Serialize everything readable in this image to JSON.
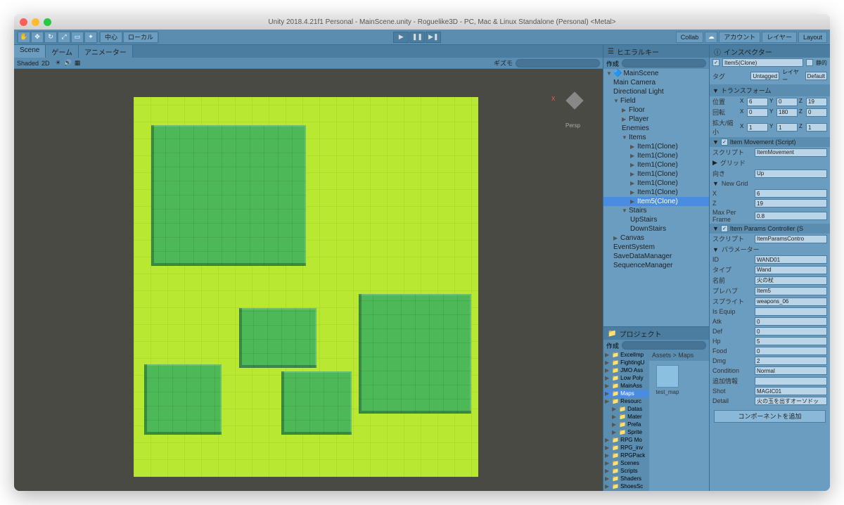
{
  "titlebar": "Unity 2018.4.21f1 Personal - MainScene.unity - Roguelike3D - PC, Mac & Linux Standalone (Personal) <Metal>",
  "toolbar": {
    "pivot": "中心",
    "local": "ローカル",
    "collab": "Collab",
    "account": "アカウント",
    "layers": "レイヤー",
    "layout": "Layout"
  },
  "sceneTabs": {
    "scene": "Scene",
    "game": "ゲーム",
    "animator": "アニメーター"
  },
  "sceneToolbar": {
    "shaded": "Shaded",
    "twod": "2D",
    "gizmos": "ギズモ"
  },
  "persp": "Persp",
  "hierarchy": {
    "title": "ヒエラルキー",
    "create": "作成",
    "scene": "MainScene",
    "items": [
      "Main Camera",
      "Directional Light",
      "Field",
      "Floor",
      "Player",
      "Enemies",
      "Items",
      "Item1(Clone)",
      "Item1(Clone)",
      "Item1(Clone)",
      "Item1(Clone)",
      "Item1(Clone)",
      "Item1(Clone)",
      "Item5(Clone)",
      "Stairs",
      "UpStairs",
      "DownStairs",
      "Canvas",
      "EventSystem",
      "SaveDataManager",
      "SequenceManager"
    ]
  },
  "project": {
    "title": "プロジェクト",
    "create": "作成",
    "breadcrumb": "Assets > Maps",
    "folders": [
      "ExcelImp",
      "FightingU",
      "JMO Ass",
      "Low Poly",
      "MainAss",
      "Maps",
      "Resourc",
      "Datas",
      "Mater",
      "Prefa",
      "Sprite",
      "RPG Mo",
      "RPG_inv",
      "RPGPack",
      "Scenes",
      "Scripts",
      "Shaders",
      "ShoesSc"
    ],
    "asset": "test_map"
  },
  "inspector": {
    "title": "インスペクター",
    "name": "Item5(Clone)",
    "static": "静的",
    "tag": "タグ",
    "tagValue": "Untagged",
    "layer": "レイヤー",
    "layerValue": "Default",
    "transform": {
      "title": "トランスフォーム",
      "pos": "位置",
      "rot": "回転",
      "scale": "拡大/縮小",
      "posX": "6",
      "posY": "0",
      "posZ": "19",
      "rotX": "0",
      "rotY": "180",
      "rotZ": "0",
      "sclX": "1",
      "sclY": "1",
      "sclZ": "1"
    },
    "itemMovement": {
      "title": "Item Movement (Script)",
      "script": "スクリプト",
      "scriptValue": "ItemMovement",
      "grid": "グリッド",
      "direction": "向き",
      "directionValue": "Up",
      "newGrid": "New Grid",
      "x": "X",
      "xValue": "6",
      "z": "Z",
      "zValue": "19",
      "maxPerFrame": "Max Per Frame",
      "maxPerFrameValue": "0.8"
    },
    "itemParams": {
      "title": "Item Params Controller (S",
      "script": "スクリプト",
      "scriptValue": "ItemParamsContro",
      "params": "パラメーター",
      "rows": [
        {
          "label": "ID",
          "value": "WAND01"
        },
        {
          "label": "タイプ",
          "value": "Wand"
        },
        {
          "label": "名前",
          "value": "火の杖"
        },
        {
          "label": "プレハブ",
          "value": "Item5"
        },
        {
          "label": "スプライト",
          "value": "weapons_06"
        },
        {
          "label": "Is Equip",
          "value": ""
        },
        {
          "label": "Atk",
          "value": "0"
        },
        {
          "label": "Def",
          "value": "0"
        },
        {
          "label": "Hp",
          "value": "5"
        },
        {
          "label": "Food",
          "value": "0"
        },
        {
          "label": "Dmg",
          "value": "2"
        },
        {
          "label": "Condition",
          "value": "Normal"
        },
        {
          "label": "追加情報",
          "value": ""
        },
        {
          "label": "Shot",
          "value": "MAGIC01"
        },
        {
          "label": "Detail",
          "value": "火の玉を出すオーソドッ"
        }
      ]
    },
    "addComponent": "コンポーネントを追加"
  }
}
